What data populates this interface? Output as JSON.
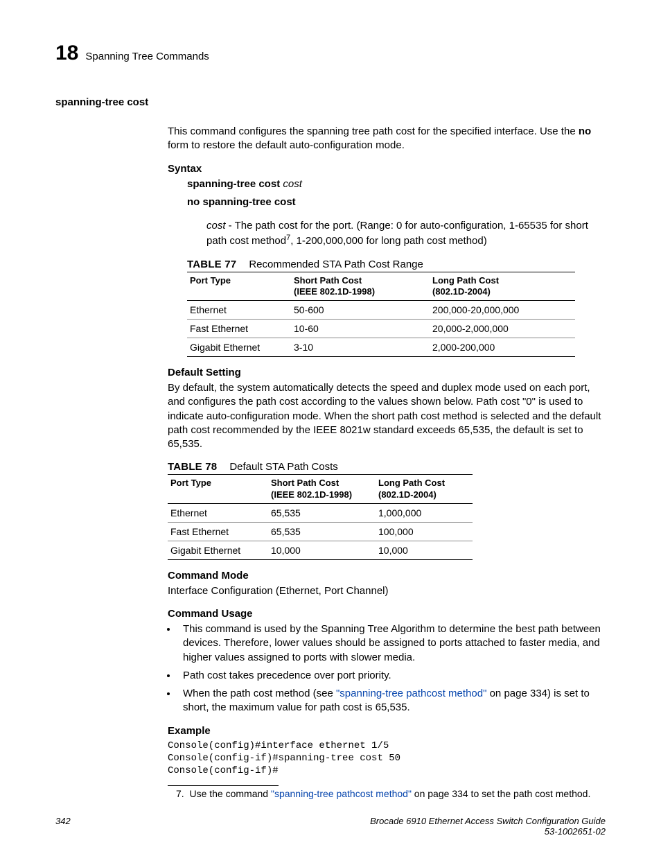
{
  "header": {
    "chapter_number": "18",
    "chapter_title": "Spanning Tree Commands"
  },
  "section_title": "spanning-tree cost",
  "intro_p1a": "This command configures the spanning tree path cost for the specified interface. Use the ",
  "intro_no": "no",
  "intro_p1b": " form to restore the default auto-configuration mode.",
  "syntax": {
    "heading": "Syntax",
    "line1_bold": "spanning-tree cost",
    "line1_ital": " cost",
    "line2": "no spanning-tree cost",
    "param_name": "cost",
    "param_desc_a": " - The path cost for the port. (Range: 0 for auto-configuration, 1-65535 for short path cost method",
    "param_sup": "7",
    "param_desc_b": ", 1-200,000,000 for long path cost method)"
  },
  "table77": {
    "label": "TABLE 77",
    "caption": "Recommended STA Path Cost Range",
    "headers": {
      "c1": "Port Type",
      "c2a": "Short Path Cost",
      "c2b": "(IEEE 802.1D-1998)",
      "c3a": "Long Path Cost",
      "c3b": "(802.1D-2004)"
    },
    "rows": [
      {
        "c1": "Ethernet",
        "c2": "50-600",
        "c3": "200,000-20,000,000"
      },
      {
        "c1": "Fast Ethernet",
        "c2": "10-60",
        "c3": "20,000-2,000,000"
      },
      {
        "c1": "Gigabit Ethernet",
        "c2": "3-10",
        "c3": "2,000-200,000"
      }
    ]
  },
  "default_setting": {
    "heading": "Default Setting",
    "text": "By default, the system automatically detects the speed and duplex mode used on each port, and configures the path cost according to the values shown below. Path cost \"0\" is used to indicate auto-configuration mode. When the short path cost method is selected and the default path cost recommended by the IEEE 8021w standard exceeds 65,535, the default is set to 65,535."
  },
  "table78": {
    "label": "TABLE 78",
    "caption": "Default STA Path Costs",
    "headers": {
      "c1": "Port Type",
      "c2a": "Short Path Cost",
      "c2b": "(IEEE 802.1D-1998)",
      "c3a": "Long Path Cost",
      "c3b": "(802.1D-2004)"
    },
    "rows": [
      {
        "c1": "Ethernet",
        "c2": "65,535",
        "c3": "1,000,000"
      },
      {
        "c1": "Fast Ethernet",
        "c2": "65,535",
        "c3": "100,000"
      },
      {
        "c1": "Gigabit Ethernet",
        "c2": "10,000",
        "c3": "10,000"
      }
    ]
  },
  "command_mode": {
    "heading": "Command Mode",
    "text": "Interface Configuration (Ethernet, Port Channel)"
  },
  "command_usage": {
    "heading": "Command Usage",
    "items": [
      {
        "pre": "This command is used by the Spanning Tree Algorithm to determine the best path between devices. Therefore, lower values should be assigned to ports attached to faster media, and higher values assigned to ports with slower media."
      },
      {
        "pre": "Path cost takes precedence over port priority."
      },
      {
        "pre": "When the path cost method (see ",
        "link": "\"spanning-tree pathcost method\"",
        "post": " on page 334) is set to short, the maximum value for path cost is 65,535."
      }
    ]
  },
  "example": {
    "heading": "Example",
    "code": "Console(config)#interface ethernet 1/5\nConsole(config-if)#spanning-tree cost 50\nConsole(config-if)#"
  },
  "footnote": {
    "num": "7.",
    "pre": "Use the command ",
    "link": "\"spanning-tree pathcost method\"",
    "post": " on page 334 to set the path cost method."
  },
  "footer": {
    "page_num": "342",
    "doc_title": "Brocade 6910 Ethernet Access Switch Configuration Guide",
    "doc_id": "53-1002651-02"
  }
}
